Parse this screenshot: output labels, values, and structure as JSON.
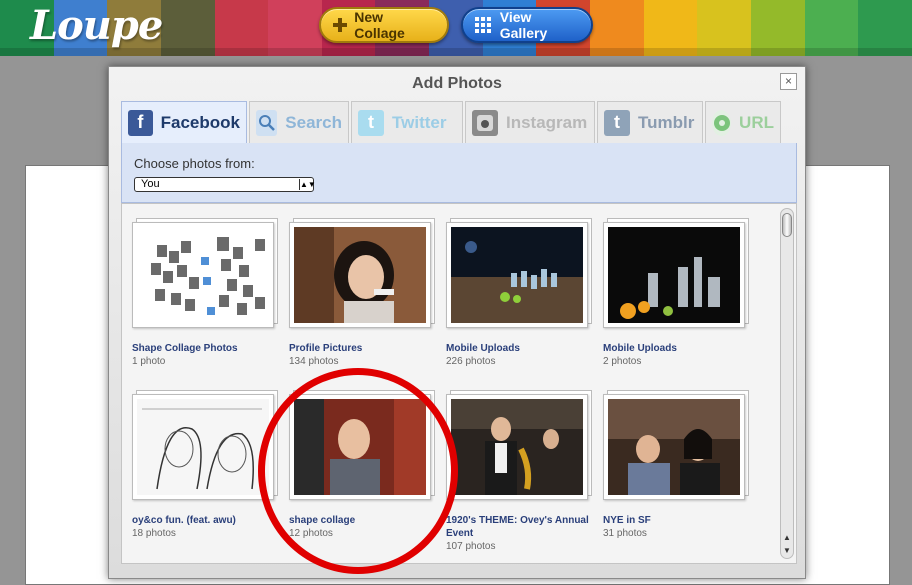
{
  "app": {
    "logo": "Loupe"
  },
  "banner_colors": [
    "#1e8b4c",
    "#3f7fcf",
    "#8f7c3b",
    "#5c5e3a",
    "#c7394a",
    "#d0405b",
    "#b8264d",
    "#8a2a5a",
    "#3e5fae",
    "#2f7fd4",
    "#d1452d",
    "#ef8a1e",
    "#f0b818",
    "#d8c21e",
    "#94ba2a",
    "#4caf50",
    "#2e9a4f"
  ],
  "toolbar": {
    "new_collage_label": "New Collage",
    "view_gallery_label": "View Gallery"
  },
  "modal": {
    "title": "Add Photos",
    "close_label": "×",
    "tabs": [
      {
        "label": "Facebook",
        "icon": "facebook-icon",
        "active": true
      },
      {
        "label": "Search",
        "icon": "search-icon"
      },
      {
        "label": "Twitter",
        "icon": "twitter-icon"
      },
      {
        "label": "Instagram",
        "icon": "instagram-icon"
      },
      {
        "label": "Tumblr",
        "icon": "tumblr-icon"
      },
      {
        "label": "URL",
        "icon": "url-icon"
      }
    ],
    "source": {
      "label": "Choose photos from:",
      "selected": "You"
    },
    "albums": [
      {
        "title": "Shape Collage Photos",
        "count": "1 photo"
      },
      {
        "title": "Profile Pictures",
        "count": "134 photos"
      },
      {
        "title": "Mobile Uploads",
        "count": "226 photos"
      },
      {
        "title": "Mobile Uploads",
        "count": "2 photos"
      },
      {
        "title": "oy&co fun. (feat. awu)",
        "count": "18 photos"
      },
      {
        "title": "shape collage",
        "count": "12 photos"
      },
      {
        "title": "1920's THEME: Ovey's Annual Event",
        "count": "107 photos"
      },
      {
        "title": "NYE in SF",
        "count": "31 photos"
      }
    ]
  }
}
